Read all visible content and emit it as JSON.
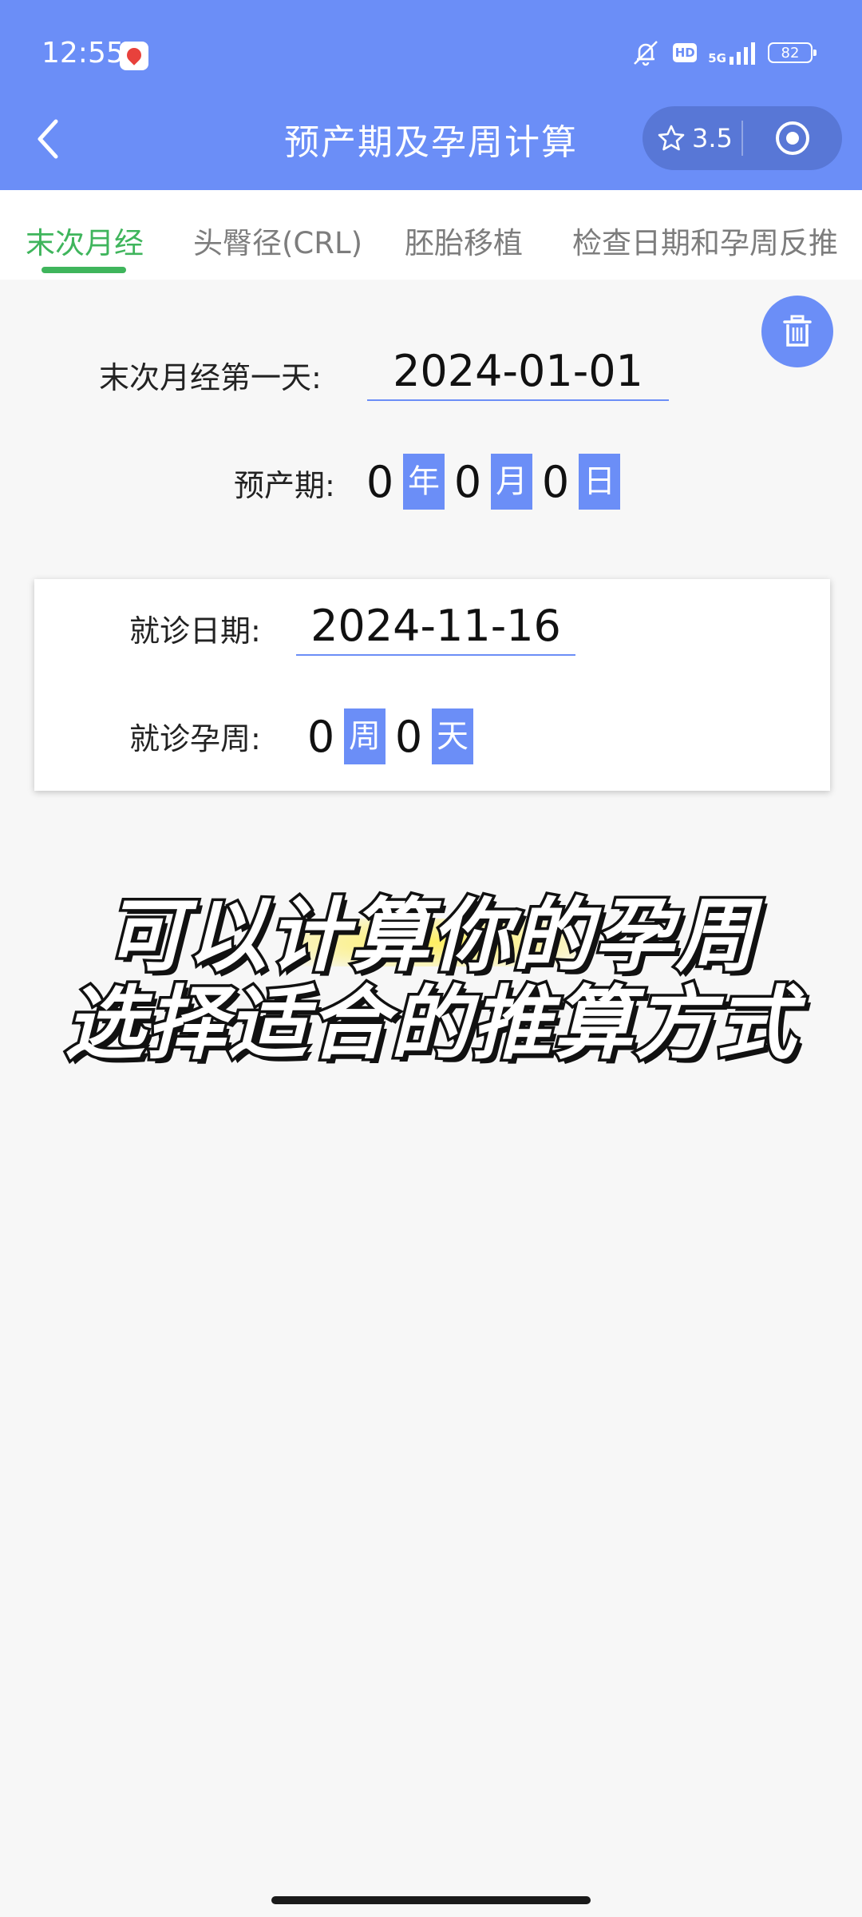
{
  "status_bar": {
    "time": "12:55",
    "network": "5G",
    "hd": "HD",
    "battery": "82"
  },
  "nav": {
    "title": "预产期及孕周计算",
    "rating": "3.5",
    "icons": {
      "back": "back-chevron",
      "star": "star-outline",
      "target": "target-circle"
    }
  },
  "tabs": [
    "末次月经",
    "头臀径(CRL)",
    "胚胎移植",
    "检查日期和孕周反推"
  ],
  "active_tab_index": 0,
  "lmp": {
    "label": "末次月经第一天:",
    "value": "2024-01-01"
  },
  "due_date": {
    "label": "预产期:",
    "year": "0",
    "year_unit": "年",
    "month": "0",
    "month_unit": "月",
    "day": "0",
    "day_unit": "日"
  },
  "visit": {
    "date_label": "就诊日期:",
    "date_value": "2024-11-16",
    "week_label": "就诊孕周:",
    "weeks": "0",
    "week_unit": "周",
    "days": "0",
    "day_unit": "天"
  },
  "caption": {
    "line1": "可以计算你的孕周",
    "line2": "选择适合的推算方式"
  },
  "colors": {
    "primary": "#6b8ef7",
    "tab_active": "#3fb55c",
    "tab_inactive": "#7d7d7d"
  }
}
